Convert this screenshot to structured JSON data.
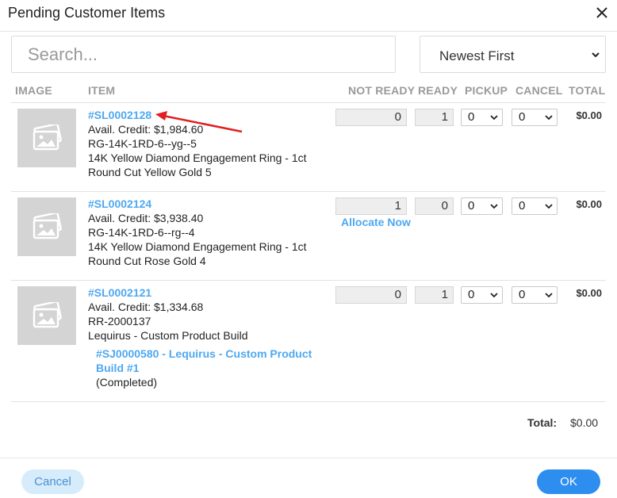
{
  "dialog": {
    "title": "Pending Customer Items"
  },
  "search": {
    "placeholder": "Search..."
  },
  "sort": {
    "selected": "Newest First"
  },
  "columns": {
    "image": "IMAGE",
    "item": "ITEM",
    "not_ready": "NOT READY",
    "ready": "READY",
    "pickup": "PICKUP",
    "cancel": "CANCEL",
    "total": "TOTAL"
  },
  "rows": [
    {
      "sku": "#SL0002128",
      "credit": "Avail. Credit: $1,984.60",
      "code": "RG-14K-1RD-6--yg--5",
      "desc1": "14K Yellow Diamond Engagement Ring - 1ct",
      "desc2": "Round Cut Yellow Gold 5",
      "not_ready": "0",
      "ready": "1",
      "pickup": "0",
      "cancel": "0",
      "total": "$0.00"
    },
    {
      "sku": "#SL0002124",
      "credit": "Avail. Credit: $3,938.40",
      "code": "RG-14K-1RD-6--rg--4",
      "desc1": "14K Yellow Diamond Engagement Ring - 1ct",
      "desc2": "Round Cut Rose Gold 4",
      "not_ready": "1",
      "ready": "0",
      "pickup": "0",
      "cancel": "0",
      "total": "$0.00",
      "action": "Allocate Now"
    },
    {
      "sku": "#SL0002121",
      "credit": "Avail. Credit: $1,334.68",
      "code": "RR-2000137",
      "desc1": "Lequirus - Custom Product Build",
      "job_link_line1": "#SJ0000580 - Lequirus - Custom Product",
      "job_link_line2": "Build #1",
      "job_status": "(Completed)",
      "not_ready": "0",
      "ready": "1",
      "pickup": "0",
      "cancel": "0",
      "total": "$0.00"
    }
  ],
  "summary": {
    "total_label": "Total:",
    "total_value": "$0.00"
  },
  "footer": {
    "cancel_label": "Cancel",
    "ok_label": "OK"
  },
  "colors": {
    "link": "#4ea8f0",
    "primary": "#2d8ef0",
    "annotation_arrow": "#e02020"
  }
}
